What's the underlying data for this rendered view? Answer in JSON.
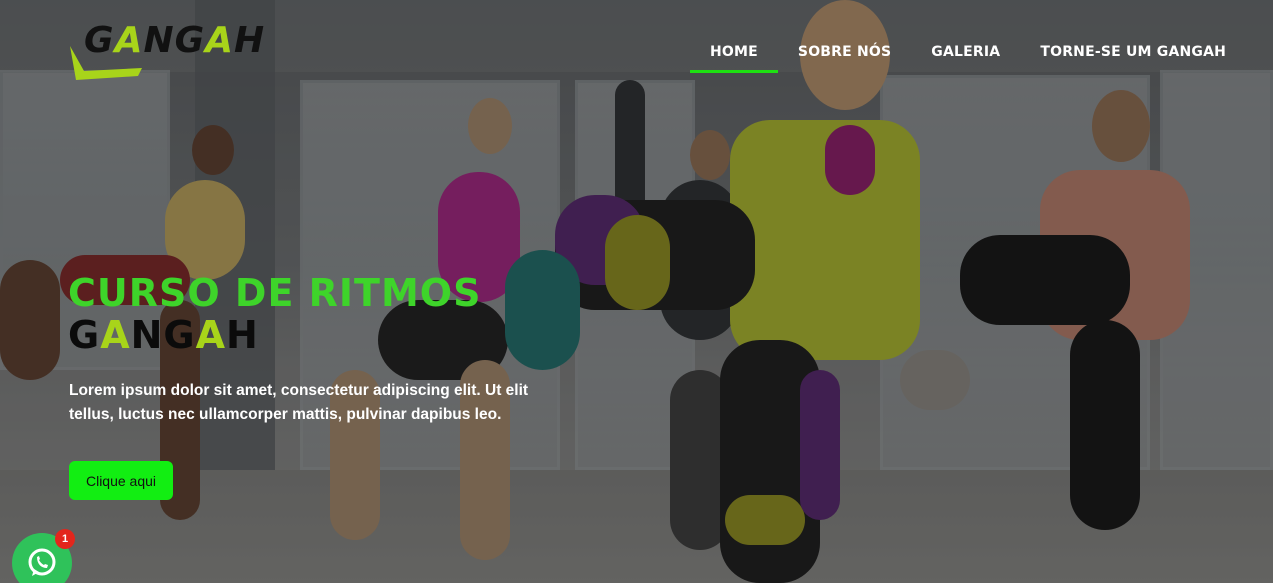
{
  "logo": {
    "text_parts": [
      "G",
      "A",
      "NG",
      "A",
      "H"
    ]
  },
  "nav": {
    "items": [
      {
        "label": "Home",
        "active": true
      },
      {
        "label": "Sobre nós",
        "active": false
      },
      {
        "label": "Galeria",
        "active": false
      },
      {
        "label": "Torne-se um Gangah",
        "active": false
      }
    ]
  },
  "hero": {
    "title_line1": "Curso de ritmos",
    "title_line2_parts": [
      "G",
      "A",
      "NG",
      "A",
      "H"
    ],
    "description": "Lorem ipsum dolor sit amet, consectetur adipiscing elit. Ut elit tellus, luctus nec ullamcorper mattis, pulvinar dapibus leo.",
    "cta_label": "Clique aqui"
  },
  "whatsapp": {
    "badge_count": "1"
  },
  "colors": {
    "accent_green": "#1ee012",
    "logo_lime": "#a8d41a",
    "title_green": "#3ed42a",
    "cta_green": "#12ee12",
    "whatsapp_green": "#2fc25a",
    "badge_red": "#e3261c"
  }
}
